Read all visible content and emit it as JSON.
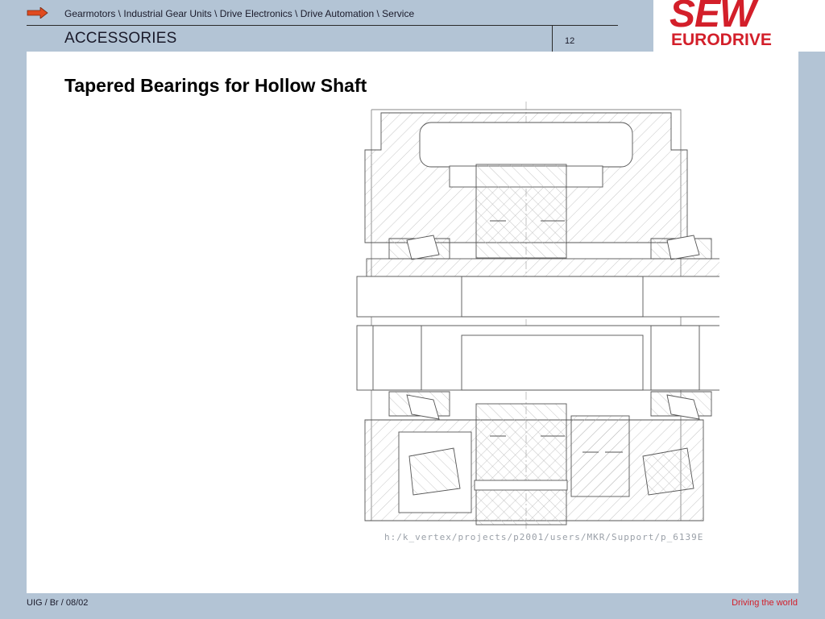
{
  "header": {
    "breadcrumb": "Gearmotors \\ Industrial Gear Units \\ Drive Electronics \\ Drive Automation \\ Service",
    "section": "ACCESSORIES",
    "page_number": "12"
  },
  "logo": {
    "line1": "SEW",
    "line2": "EURODRIVE"
  },
  "slide": {
    "title": "Tapered Bearings for Hollow Shaft",
    "drawing_path": "h:/k_vertex/projects/p2001/users/MKR/Support/p_6139E"
  },
  "footer": {
    "left": "UIG / Br / 08/02",
    "right": "Driving the world"
  },
  "colors": {
    "brand_red": "#d31f2a",
    "band": "#b3c4d5",
    "arrow": "#e04a1f"
  },
  "icons": {
    "nav_arrow": "arrow-right-icon"
  }
}
